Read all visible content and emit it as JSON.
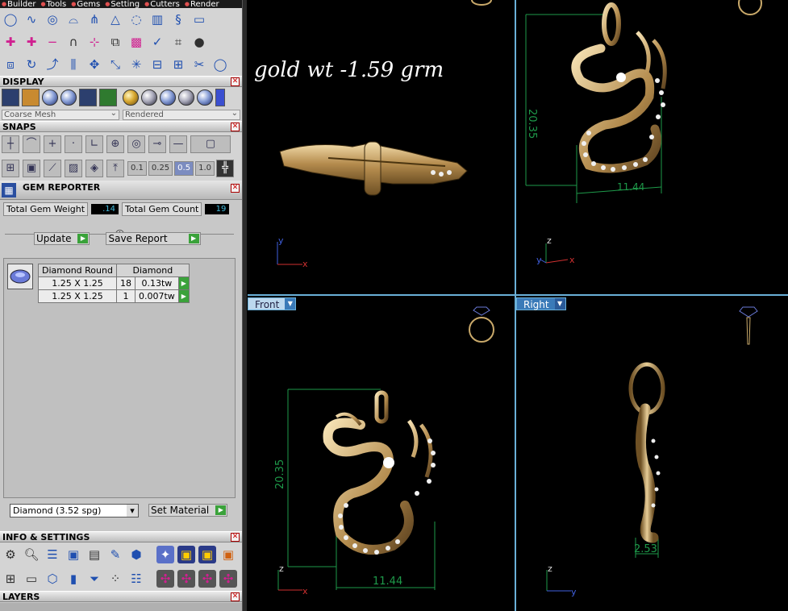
{
  "menu": [
    "Builder",
    "Tools",
    "Gems",
    "Setting",
    "Cutters",
    "Render"
  ],
  "display": {
    "title": "DISPLAY",
    "mesh_mode": "Coarse Mesh",
    "render_mode": "Rendered"
  },
  "snaps": {
    "title": "SNAPS",
    "increments": [
      "0.1",
      "0.25",
      "0.5",
      "1.0"
    ],
    "active_increment": "0.5"
  },
  "gem_reporter": {
    "title": "GEM REPORTER",
    "total_weight_label": "Total Gem Weight",
    "total_weight": ".14",
    "total_count_label": "Total Gem Count",
    "total_count": "19",
    "update_label": "Update",
    "save_report_label": "Save Report",
    "table_headers": [
      "Diamond Round",
      "Diamond"
    ],
    "rows": [
      {
        "size": "1.25 X 1.25",
        "count": "18",
        "weight": "0.13tw"
      },
      {
        "size": "1.25 X 1.25",
        "count": "1",
        "weight": "0.007tw"
      }
    ],
    "material": "Diamond    (3.52 spg)",
    "set_material_label": "Set Material"
  },
  "info_settings": {
    "title": "INFO & SETTINGS"
  },
  "layers": {
    "title": "LAYERS"
  },
  "viewports": {
    "note": "gold  wt -1.59  grm",
    "top_right": {
      "height_dim": "20.35",
      "width_dim": "11.44"
    },
    "front": {
      "label": "Front",
      "height_dim": "20.35",
      "width_dim": "11.44"
    },
    "right": {
      "label": "Right",
      "depth_dim": "2.53"
    }
  },
  "colors": {
    "accent": "#6ab0d8",
    "gold": "#c9a96a",
    "dimension": "#1e9a4a",
    "axis_x": "#d03030",
    "axis_y": "#4060e0"
  }
}
